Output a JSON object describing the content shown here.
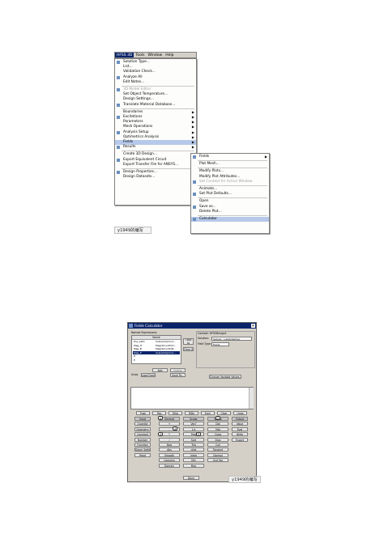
{
  "menubar": [
    "HFSS 3D",
    "Tools",
    "Window",
    "Help"
  ],
  "main_menu": [
    {
      "label": "Solution Type..."
    },
    {
      "label": "List..."
    },
    {
      "label": "Validation Check..."
    },
    {
      "label": "Analyze All"
    },
    {
      "label": "Edit Notes..."
    },
    {
      "sep": true
    },
    {
      "label": "3D Model Editor",
      "disabled": true
    },
    {
      "label": "Set Object Temperature..."
    },
    {
      "label": "Design Settings..."
    },
    {
      "label": "Translate Material Database..."
    },
    {
      "sep": true
    },
    {
      "label": "Boundaries",
      "sub": true
    },
    {
      "label": "Excitations",
      "sub": true
    },
    {
      "label": "Parameters",
      "sub": true
    },
    {
      "label": "Mesh Operations",
      "sub": true
    },
    {
      "label": "Analysis Setup",
      "sub": true
    },
    {
      "label": "Optimetrics Analysis",
      "sub": true
    },
    {
      "label": "Fields",
      "sub": true,
      "selected": true
    },
    {
      "label": "Results",
      "sub": true
    },
    {
      "sep": true
    },
    {
      "label": "Create 3D Design..."
    },
    {
      "label": "Export Equivalent Circuit",
      "sub": true
    },
    {
      "label": "Export Transfer File for ANSYS..."
    },
    {
      "sep": true
    },
    {
      "label": "Design Properties..."
    },
    {
      "label": "Design Datasets..."
    }
  ],
  "fields_menu": [
    {
      "label": "Fields",
      "sub": true
    },
    {
      "sep": true
    },
    {
      "label": "Plot Mesh..."
    },
    {
      "sep": true
    },
    {
      "label": "Modify Plots..."
    },
    {
      "label": "Modify Plot Attributes..."
    },
    {
      "label": "Set Context for Active Window",
      "disabled": true
    },
    {
      "sep": true
    },
    {
      "label": "Animate..."
    },
    {
      "label": "Set Plot Defaults..."
    },
    {
      "sep": true
    },
    {
      "label": "Open"
    },
    {
      "label": "Save as..."
    },
    {
      "label": "Delete Plot..."
    },
    {
      "sep": true
    },
    {
      "label": "Calculator",
      "selected": true
    }
  ],
  "watermark_1": "y1949的编写",
  "watermark_2": "y1949的编写",
  "calc": {
    "title": "Fields Calculator",
    "named_expr_label": "Named Expressions",
    "col_name": "Name",
    "expr_names": [
      "Poy_Lettr",
      "Mag_H",
      "Mag_B",
      "Mag_E",
      "H",
      "E"
    ],
    "expr_values": [
      "Scalar(D)(mod...",
      "Mag(Smooth(H...",
      "Mag(Smooth(B...",
      "Scalar(D)(mod...",
      "",
      ""
    ],
    "btn_copy": "Copy to stack",
    "btn_clear": "Clear All",
    "btn_add": "Add",
    "btn_delete": "Delete",
    "btn_undo_edit": "Undo",
    "btn_load": "Load From...",
    "btn_save": "Save To...",
    "context_label": "Context: HFSSDesign1",
    "solution_label": "Solution:",
    "solution_value": "Setup1 : LastAdaptive",
    "fieldtype_label": "Field Type:",
    "fieldtype_value": "Fields",
    "btn_change_vars": "Change Variable Values...",
    "top_row": [
      "Push",
      "Pop",
      "RlUp",
      "RlDn",
      "Exch",
      "Clear",
      "Undo"
    ],
    "rows": [
      [
        "Input",
        "General",
        "Scalar",
        "Vector",
        "Output"
      ],
      [
        "Quantity",
        "+",
        "Vec?",
        "Dot",
        "Value"
      ],
      [
        "Geometry",
        "-",
        "1/x",
        "Mat",
        "Eval"
      ],
      [
        "Constant",
        "*",
        "Pow",
        "Cross",
        "Write"
      ],
      [
        "Number",
        "/",
        "Sqrt",
        "Divg",
        "Export"
      ],
      [
        "Function",
        "Neg",
        "Trig",
        "Curl",
        ""
      ],
      [
        "Geom Settings",
        "Abs",
        "d/dx",
        "Tangent",
        ""
      ],
      [
        "Read",
        "Smooth",
        "Integ",
        "Normal",
        ""
      ],
      [
        "",
        "Complex",
        "Min",
        "Unit Vec",
        ""
      ],
      [
        "",
        "Domain",
        "Max",
        "",
        ""
      ]
    ],
    "markers": [
      "1",
      "2",
      "3",
      "4",
      "5"
    ],
    "btn_done": "Done"
  }
}
